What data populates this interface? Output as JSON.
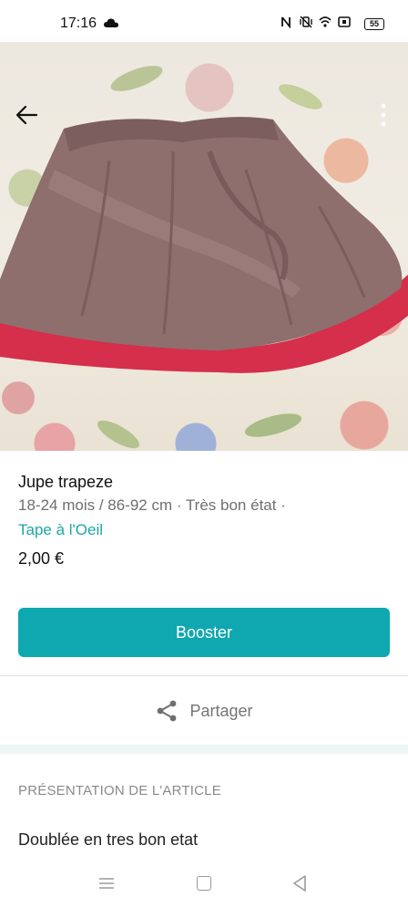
{
  "status_bar": {
    "time": "17:16",
    "battery": "55",
    "icons": [
      "cloud-icon",
      "nfc-icon",
      "vibrate-icon",
      "wifi-icon",
      "cast-icon",
      "battery-icon"
    ]
  },
  "photo": {
    "alt_icons": [
      "back-arrow-icon",
      "more-vertical-icon"
    ]
  },
  "item": {
    "title": "Jupe trapeze",
    "meta": "18-24 mois / 86-92 cm · Très bon état ·",
    "brand": "Tape à l'Oeil",
    "price": "2,00 €"
  },
  "actions": {
    "boost_label": "Booster",
    "share_label": "Partager"
  },
  "description_section": {
    "header": "PRÉSENTATION DE L'ARTICLE",
    "text": "Doublée en tres bon etat"
  },
  "colors": {
    "accent": "#0fa8b0",
    "brand_text": "#1ea7a7"
  }
}
